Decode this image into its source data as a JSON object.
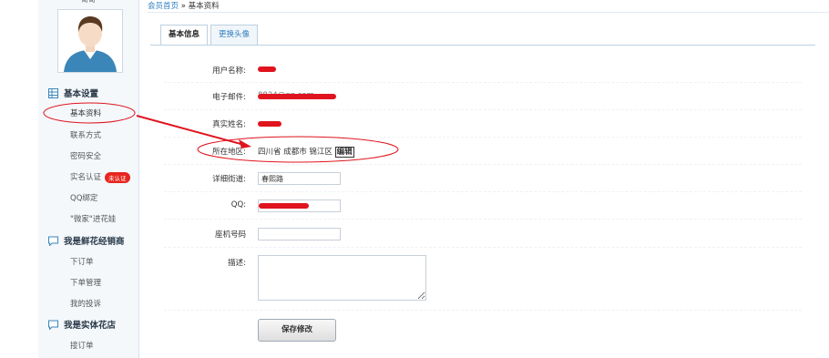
{
  "sidebar": {
    "username": "哥哥",
    "groups": [
      {
        "label": "基本设置",
        "icon": "settings-grid-icon"
      },
      {
        "label": "我是鲜花经销商",
        "icon": "chat-bubble-icon"
      },
      {
        "label": "我是实体花店",
        "icon": "chat-bubble-icon"
      }
    ],
    "items": [
      {
        "label": "基本资料"
      },
      {
        "label": "联系方式"
      },
      {
        "label": "密码安全"
      },
      {
        "label": "实名认证",
        "badge": "未认证"
      },
      {
        "label": "QQ绑定"
      },
      {
        "label": "\"微家\"进花娃"
      },
      {
        "label": "下订单"
      },
      {
        "label": "下单管理"
      },
      {
        "label": "我的投诉"
      },
      {
        "label": "接订单"
      }
    ]
  },
  "breadcrumb": {
    "home": "会员首页",
    "sep": "»",
    "current": "基本资料"
  },
  "tabs": [
    {
      "label": "基本信息",
      "active": true
    },
    {
      "label": "更换头像",
      "active": false
    }
  ],
  "form": {
    "username_label": "用户名称:",
    "email_label": "电子邮件:",
    "email_value": "8824@qq.com",
    "realname_label": "真实姓名:",
    "region_label": "所在地区:",
    "region_value": "四川省 成都市 锦江区",
    "region_edit": "编辑",
    "street_label": "详细街道:",
    "street_value": "春熙路",
    "qq_label": "QQ:",
    "phone_label": "座机号码",
    "desc_label": "描述:",
    "save_label": "保存修改"
  },
  "colors": {
    "accent": "#2d7fc1",
    "annotation": "#e0141e",
    "badge": "#e8251e"
  }
}
